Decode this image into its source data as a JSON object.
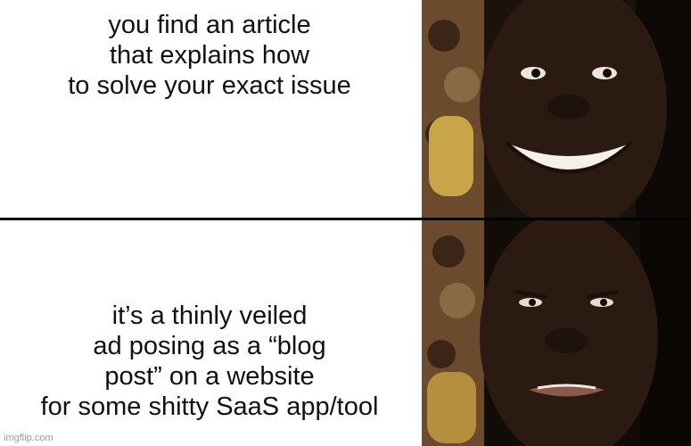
{
  "meme": {
    "top_caption": "you find an article\nthat explains how\nto solve your exact issue",
    "bottom_caption": "it’s a thinly veiled\nad posing as a “blog\npost” on a website\nfor some shitty SaaS app/tool",
    "watermark": "imgflip.com"
  },
  "colors": {
    "background": "#ffffff",
    "text": "#111111",
    "divider": "#000000",
    "skin": "#2b1a12",
    "wallpaper": "#7a5a3a",
    "cushion": "#c9a54a"
  }
}
